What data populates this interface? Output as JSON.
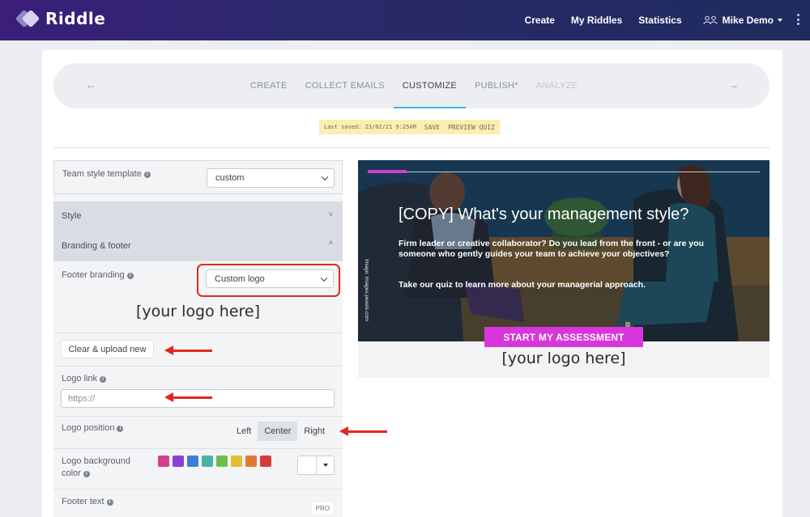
{
  "app": {
    "name": "Riddle"
  },
  "nav": {
    "create": "Create",
    "my_riddles": "My Riddles",
    "statistics": "Statistics",
    "user": "Mike Demo"
  },
  "steps": {
    "back": "←",
    "next": "→",
    "items": [
      "CREATE",
      "COLLECT EMAILS",
      "CUSTOMIZE",
      "PUBLISH*",
      "ANALYZE"
    ],
    "active": "CUSTOMIZE"
  },
  "save_bar": {
    "last_saved": "Last saved: 23/02/21 9:25AM",
    "save": "SAVE",
    "preview": "PREVIEW QUIZ"
  },
  "panel": {
    "team_style_label": "Team style template",
    "team_style_value": "custom",
    "style_section": "Style",
    "branding_section": "Branding & footer",
    "footer_branding_label": "Footer branding",
    "footer_branding_value": "Custom logo",
    "logo_placeholder": "[your logo here]",
    "clear_upload": "Clear & upload new",
    "logo_link_label": "Logo link",
    "logo_link_placeholder": "https://",
    "logo_position_label": "Logo position",
    "positions": [
      "Left",
      "Center",
      "Right"
    ],
    "position_selected": "Center",
    "logo_bg_label_1": "Logo background",
    "logo_bg_label_2": "color",
    "swatch_colors": [
      "#d43f8d",
      "#8b3fd9",
      "#3c7fd6",
      "#45b3a6",
      "#6cc04a",
      "#e0c030",
      "#e07a33",
      "#d63c3c"
    ],
    "footer_text_label": "Footer text",
    "pro_badge": "PRO",
    "info_glyph": "i"
  },
  "preview": {
    "progress": 0.1,
    "title": "[COPY] What's your management style?",
    "description": "Firm leader or creative collaborator? Do you lead from the front - or are you someone who gently guides your team to achieve your objectives?",
    "cta_bold": "Take our quiz",
    "cta_rest": " to learn more about your managerial approach.",
    "image_credit": "Image: images.pexels.com",
    "start_button": "START MY ASSESSMENT",
    "logo_placeholder": "[your logo here]"
  },
  "colors": {
    "accent_blue": "#38b6e6",
    "brand_magenta": "#d836dc",
    "annotation_red": "#e0281e"
  }
}
